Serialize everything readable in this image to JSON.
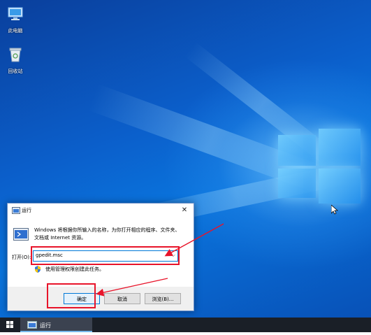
{
  "desktop": {
    "icons": [
      {
        "label": "此电脑",
        "icon": "computer-icon"
      },
      {
        "label": "回收站",
        "icon": "recycle-bin-icon"
      }
    ]
  },
  "dialog": {
    "title": "运行",
    "close_glyph": "✕",
    "description": "Windows 将根据你所输入的名称，为你打开相应的程序、文件夹、文档或 Internet 资源。",
    "open_label": "打开(O):",
    "input_value": "gpedit.msc",
    "dropdown_glyph": "⌵",
    "admin_text": "使用管理权限创建此任务。",
    "buttons": {
      "ok": "确定",
      "cancel": "取消",
      "browse": "浏览(B)..."
    }
  },
  "taskbar": {
    "running_app": "运行"
  },
  "colors": {
    "highlight": "#e8142a",
    "accent": "#0078d7"
  }
}
